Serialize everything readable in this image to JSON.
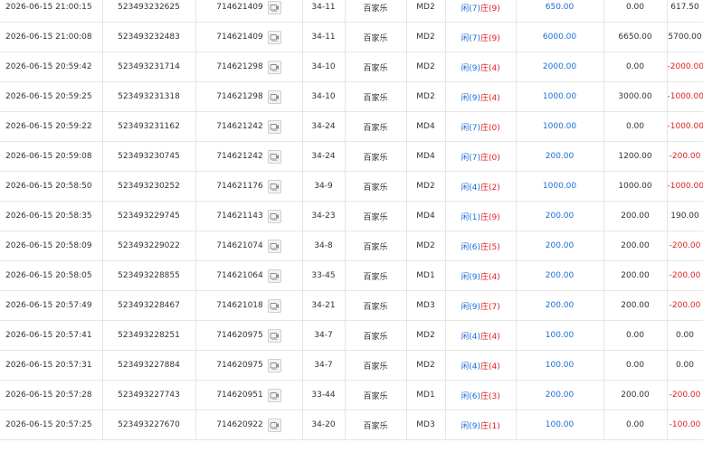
{
  "colors": {
    "player": "#1a6fd6",
    "banker": "#e02020",
    "negative": "#e02020",
    "bet": "#1a6fd6"
  },
  "icons": {
    "replay": "video-replay-icon"
  },
  "rows": [
    {
      "time": "2026-06-15 21:00:15",
      "order_id": "523493232625",
      "game_id": "714621409",
      "shoe_round": "34-11",
      "game_type": "百家乐",
      "table": "MD2",
      "player_label": "闲",
      "player_score": "(7)",
      "banker_label": "庄",
      "banker_score": "(9)",
      "bet": "650.00",
      "valid_bet": "0.00",
      "win_loss": "617.50",
      "win_negative": false
    },
    {
      "time": "2026-06-15 21:00:08",
      "order_id": "523493232483",
      "game_id": "714621409",
      "shoe_round": "34-11",
      "game_type": "百家乐",
      "table": "MD2",
      "player_label": "闲",
      "player_score": "(7)",
      "banker_label": "庄",
      "banker_score": "(9)",
      "bet": "6000.00",
      "valid_bet": "6650.00",
      "win_loss": "5700.00",
      "win_negative": false
    },
    {
      "time": "2026-06-15 20:59:42",
      "order_id": "523493231714",
      "game_id": "714621298",
      "shoe_round": "34-10",
      "game_type": "百家乐",
      "table": "MD2",
      "player_label": "闲",
      "player_score": "(9)",
      "banker_label": "庄",
      "banker_score": "(4)",
      "bet": "2000.00",
      "valid_bet": "0.00",
      "win_loss": "-2000.00",
      "win_negative": true
    },
    {
      "time": "2026-06-15 20:59:25",
      "order_id": "523493231318",
      "game_id": "714621298",
      "shoe_round": "34-10",
      "game_type": "百家乐",
      "table": "MD2",
      "player_label": "闲",
      "player_score": "(9)",
      "banker_label": "庄",
      "banker_score": "(4)",
      "bet": "1000.00",
      "valid_bet": "3000.00",
      "win_loss": "-1000.00",
      "win_negative": true
    },
    {
      "time": "2026-06-15 20:59:22",
      "order_id": "523493231162",
      "game_id": "714621242",
      "shoe_round": "34-24",
      "game_type": "百家乐",
      "table": "MD4",
      "player_label": "闲",
      "player_score": "(7)",
      "banker_label": "庄",
      "banker_score": "(0)",
      "bet": "1000.00",
      "valid_bet": "0.00",
      "win_loss": "-1000.00",
      "win_negative": true
    },
    {
      "time": "2026-06-15 20:59:08",
      "order_id": "523493230745",
      "game_id": "714621242",
      "shoe_round": "34-24",
      "game_type": "百家乐",
      "table": "MD4",
      "player_label": "闲",
      "player_score": "(7)",
      "banker_label": "庄",
      "banker_score": "(0)",
      "bet": "200.00",
      "valid_bet": "1200.00",
      "win_loss": "-200.00",
      "win_negative": true
    },
    {
      "time": "2026-06-15 20:58:50",
      "order_id": "523493230252",
      "game_id": "714621176",
      "shoe_round": "34-9",
      "game_type": "百家乐",
      "table": "MD2",
      "player_label": "闲",
      "player_score": "(4)",
      "banker_label": "庄",
      "banker_score": "(2)",
      "bet": "1000.00",
      "valid_bet": "1000.00",
      "win_loss": "-1000.00",
      "win_negative": true
    },
    {
      "time": "2026-06-15 20:58:35",
      "order_id": "523493229745",
      "game_id": "714621143",
      "shoe_round": "34-23",
      "game_type": "百家乐",
      "table": "MD4",
      "player_label": "闲",
      "player_score": "(1)",
      "banker_label": "庄",
      "banker_score": "(9)",
      "bet": "200.00",
      "valid_bet": "200.00",
      "win_loss": "190.00",
      "win_negative": false
    },
    {
      "time": "2026-06-15 20:58:09",
      "order_id": "523493229022",
      "game_id": "714621074",
      "shoe_round": "34-8",
      "game_type": "百家乐",
      "table": "MD2",
      "player_label": "闲",
      "player_score": "(6)",
      "banker_label": "庄",
      "banker_score": "(5)",
      "bet": "200.00",
      "valid_bet": "200.00",
      "win_loss": "-200.00",
      "win_negative": true
    },
    {
      "time": "2026-06-15 20:58:05",
      "order_id": "523493228855",
      "game_id": "714621064",
      "shoe_round": "33-45",
      "game_type": "百家乐",
      "table": "MD1",
      "player_label": "闲",
      "player_score": "(9)",
      "banker_label": "庄",
      "banker_score": "(4)",
      "bet": "200.00",
      "valid_bet": "200.00",
      "win_loss": "-200.00",
      "win_negative": true
    },
    {
      "time": "2026-06-15 20:57:49",
      "order_id": "523493228467",
      "game_id": "714621018",
      "shoe_round": "34-21",
      "game_type": "百家乐",
      "table": "MD3",
      "player_label": "闲",
      "player_score": "(9)",
      "banker_label": "庄",
      "banker_score": "(7)",
      "bet": "200.00",
      "valid_bet": "200.00",
      "win_loss": "-200.00",
      "win_negative": true
    },
    {
      "time": "2026-06-15 20:57:41",
      "order_id": "523493228251",
      "game_id": "714620975",
      "shoe_round": "34-7",
      "game_type": "百家乐",
      "table": "MD2",
      "player_label": "闲",
      "player_score": "(4)",
      "banker_label": "庄",
      "banker_score": "(4)",
      "bet": "100.00",
      "valid_bet": "0.00",
      "win_loss": "0.00",
      "win_negative": false
    },
    {
      "time": "2026-06-15 20:57:31",
      "order_id": "523493227884",
      "game_id": "714620975",
      "shoe_round": "34-7",
      "game_type": "百家乐",
      "table": "MD2",
      "player_label": "闲",
      "player_score": "(4)",
      "banker_label": "庄",
      "banker_score": "(4)",
      "bet": "100.00",
      "valid_bet": "0.00",
      "win_loss": "0.00",
      "win_negative": false
    },
    {
      "time": "2026-06-15 20:57:28",
      "order_id": "523493227743",
      "game_id": "714620951",
      "shoe_round": "33-44",
      "game_type": "百家乐",
      "table": "MD1",
      "player_label": "闲",
      "player_score": "(6)",
      "banker_label": "庄",
      "banker_score": "(3)",
      "bet": "200.00",
      "valid_bet": "200.00",
      "win_loss": "-200.00",
      "win_negative": true
    },
    {
      "time": "2026-06-15 20:57:25",
      "order_id": "523493227670",
      "game_id": "714620922",
      "shoe_round": "34-20",
      "game_type": "百家乐",
      "table": "MD3",
      "player_label": "闲",
      "player_score": "(9)",
      "banker_label": "庄",
      "banker_score": "(1)",
      "bet": "100.00",
      "valid_bet": "0.00",
      "win_loss": "-100.00",
      "win_negative": true
    }
  ]
}
